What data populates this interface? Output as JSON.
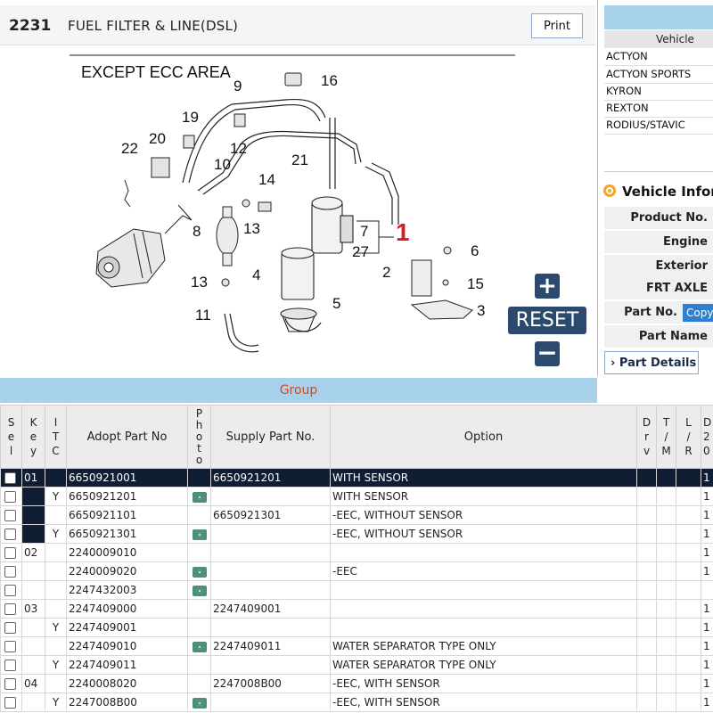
{
  "header": {
    "code": "2231",
    "title": "FUEL FILTER & LINE(DSL)",
    "print_label": "Print"
  },
  "diagram": {
    "caption": "EXCEPT ECC AREA",
    "callouts": [
      "1",
      "2",
      "3",
      "4",
      "5",
      "6",
      "7",
      "8",
      "9",
      "10",
      "11",
      "12",
      "13",
      "13",
      "14",
      "15",
      "16",
      "19",
      "20",
      "21",
      "22",
      "27"
    ]
  },
  "controls": {
    "zoom_in": "+",
    "reset": "RESET",
    "zoom_out": "−"
  },
  "vehicle_panel": {
    "header": "Vehicle",
    "vehicles": [
      "ACTYON",
      "ACTYON SPORTS",
      "KYRON",
      "REXTON",
      "RODIUS/STAVIC"
    ]
  },
  "vehicle_info": {
    "title": "Vehicle Inform",
    "rows": [
      "Product No.",
      "Engine",
      "Exterior",
      "FRT AXLE",
      "Part No.",
      "Part Name"
    ],
    "copy_label": "Copy",
    "part_details_label": "Part Details"
  },
  "group_label": "Group",
  "table": {
    "headers": {
      "sel": "S\ne\nl",
      "key": "K\ne\ny",
      "itc": "I\nT\nC",
      "adopt": "Adopt Part No",
      "photo": "P\nh\no\nt\no",
      "supply": "Supply Part No.",
      "option": "Option",
      "drv": "D\nr\nv",
      "tm": "T\n/\nM",
      "lr": "L\n/\nR",
      "d": "D\n2\n0"
    },
    "rows": [
      {
        "key": "01",
        "itc": "",
        "adopt": "6650921001",
        "photo": false,
        "supply": "6650921201",
        "option": "WITH SENSOR",
        "d": "1"
      },
      {
        "key": "",
        "itc": "Y",
        "adopt": "6650921201",
        "photo": true,
        "supply": "",
        "option": "WITH SENSOR",
        "d": "1"
      },
      {
        "key": "",
        "itc": "",
        "adopt": "6650921101",
        "photo": false,
        "supply": "6650921301",
        "option": "-EEC, WITHOUT SENSOR",
        "d": "1"
      },
      {
        "key": "",
        "itc": "Y",
        "adopt": "6650921301",
        "photo": true,
        "supply": "",
        "option": "-EEC, WITHOUT SENSOR",
        "d": "1"
      },
      {
        "key": "02",
        "itc": "",
        "adopt": "2240009010",
        "photo": false,
        "supply": "",
        "option": "",
        "d": "1"
      },
      {
        "key": "",
        "itc": "",
        "adopt": "2240009020",
        "photo": true,
        "supply": "",
        "option": "-EEC",
        "d": "1"
      },
      {
        "key": "",
        "itc": "",
        "adopt": "2247432003",
        "photo": true,
        "supply": "",
        "option": "",
        "d": ""
      },
      {
        "key": "03",
        "itc": "",
        "adopt": "2247409000",
        "photo": false,
        "supply": "2247409001",
        "option": "",
        "d": "1"
      },
      {
        "key": "",
        "itc": "Y",
        "adopt": "2247409001",
        "photo": false,
        "supply": "",
        "option": "",
        "d": "1"
      },
      {
        "key": "",
        "itc": "",
        "adopt": "2247409010",
        "photo": true,
        "supply": "2247409011",
        "option": "WATER SEPARATOR TYPE ONLY",
        "d": "1"
      },
      {
        "key": "",
        "itc": "Y",
        "adopt": "2247409011",
        "photo": false,
        "supply": "",
        "option": "WATER SEPARATOR TYPE ONLY",
        "d": "1"
      },
      {
        "key": "04",
        "itc": "",
        "adopt": "2240008020",
        "photo": false,
        "supply": "2247008B00",
        "option": "-EEC, WITH SENSOR",
        "d": "1"
      },
      {
        "key": "",
        "itc": "Y",
        "adopt": "2247008B00",
        "photo": true,
        "supply": "",
        "option": "-EEC, WITH SENSOR",
        "d": "1"
      }
    ]
  },
  "colors": {
    "accent_dark": "#0f1e33",
    "header_blue": "#a8d2ec",
    "group_text": "#d04a20",
    "callout_red": "#d62020",
    "button_navy": "#2c4a6e"
  }
}
